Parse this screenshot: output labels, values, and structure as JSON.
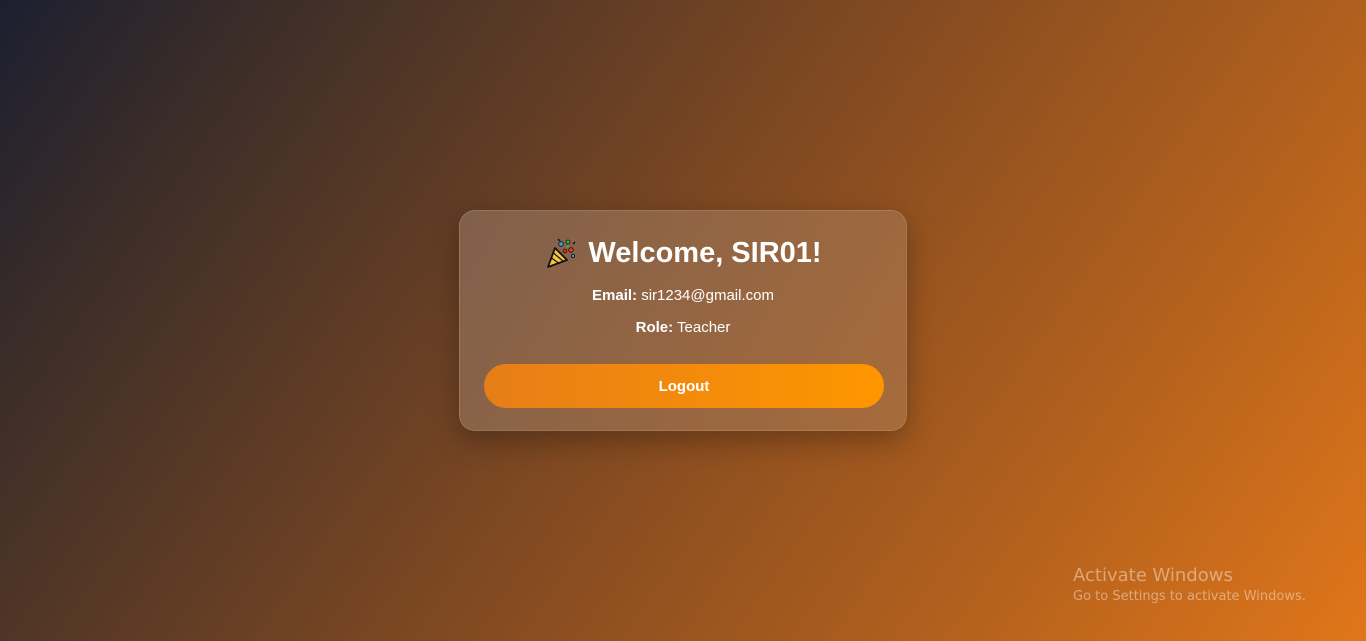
{
  "card": {
    "icon": "party-popper-icon",
    "title": "Welcome, SIR01!",
    "email_label": "Email:",
    "email_value": "sir1234@gmail.com",
    "role_label": "Role:",
    "role_value": "Teacher",
    "logout_label": "Logout"
  },
  "watermark": {
    "title": "Activate Windows",
    "subtitle": "Go to Settings to activate Windows."
  },
  "colors": {
    "button_start": "#e67e18",
    "button_end": "#ff9600",
    "background_start": "#1c1f30",
    "background_end": "#e0761a"
  }
}
